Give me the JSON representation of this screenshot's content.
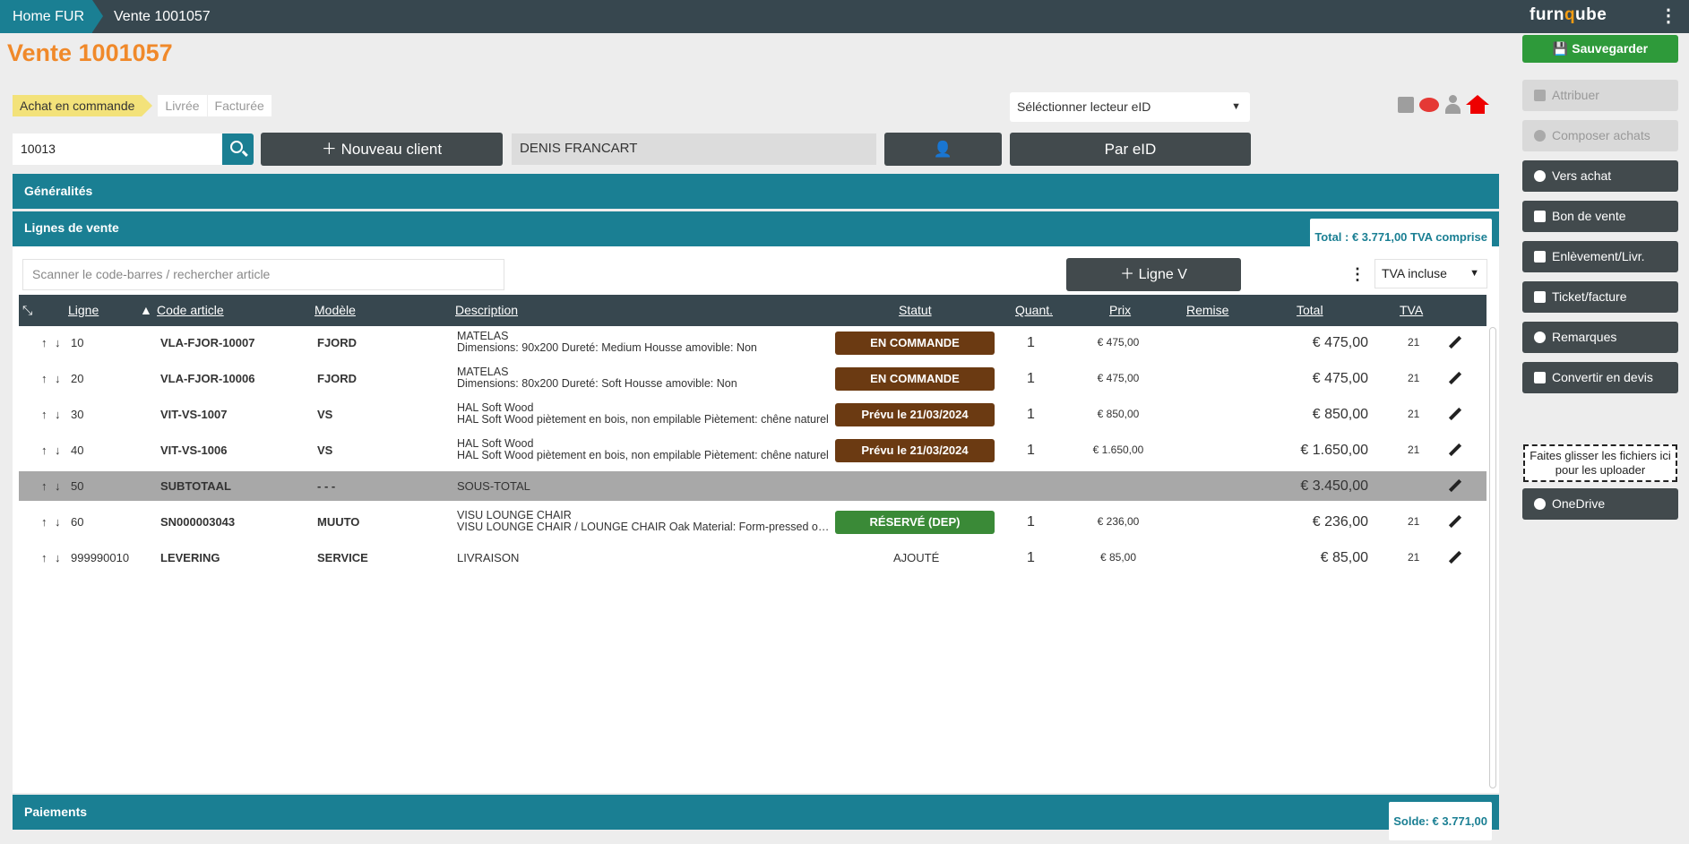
{
  "topbar": {
    "home": "Home FUR",
    "current": "Vente 1001057",
    "logo_a": "furn",
    "logo_q": "q",
    "logo_b": "ube"
  },
  "page_title": "Vente 1001057",
  "steps": [
    "Achat en commande",
    "Livrée",
    "Facturée"
  ],
  "eid_select": "Séléctionner lecteur eID",
  "client": {
    "number": "10013",
    "new_client": "Nouveau client",
    "name": "DENIS FRANCART",
    "by_eid": "Par eID"
  },
  "panels": {
    "generalites": "Généralités",
    "lignes": "Lignes de vente",
    "total": "Total : € 3.771,00 TVA comprise",
    "paiements": "Paiements",
    "solde": "Solde: € 3.771,00"
  },
  "lines": {
    "scan_placeholder": "Scanner le code-barres / rechercher article",
    "add_line": "Ligne V",
    "tva_select": "TVA incluse"
  },
  "columns": {
    "ligne": "Ligne",
    "code": "Code article",
    "modele": "Modèle",
    "description": "Description",
    "statut": "Statut",
    "quant": "Quant.",
    "prix": "Prix",
    "remise": "Remise",
    "total": "Total",
    "tva": "TVA"
  },
  "rows": [
    {
      "ligne": "10",
      "code": "VLA-FJOR-10007",
      "modele": "FJORD",
      "d1": "MATELAS",
      "d2": "Dimensions: 90x200 Dureté: Medium Housse amovible: Non",
      "statut": "EN COMMANDE",
      "color": "#6b3a12",
      "qty": "1",
      "prix": "€ 475,00",
      "total": "€ 475,00",
      "tva": "21"
    },
    {
      "ligne": "20",
      "code": "VLA-FJOR-10006",
      "modele": "FJORD",
      "d1": "MATELAS",
      "d2": "Dimensions: 80x200 Dureté: Soft Housse amovible: Non",
      "statut": "EN COMMANDE",
      "color": "#6b3a12",
      "qty": "1",
      "prix": "€ 475,00",
      "total": "€ 475,00",
      "tva": "21"
    },
    {
      "ligne": "30",
      "code": "VIT-VS-1007",
      "modele": "VS",
      "d1": "HAL Soft Wood",
      "d2": "HAL Soft Wood piètement en bois, non empilable Piètement: chêne naturel",
      "statut": "Prévu le 21/03/2024",
      "color": "#6b3a12",
      "qty": "1",
      "prix": "€ 850,00",
      "total": "€ 850,00",
      "tva": "21"
    },
    {
      "ligne": "40",
      "code": "VIT-VS-1006",
      "modele": "VS",
      "d1": "HAL Soft Wood",
      "d2": "HAL Soft Wood piètement en bois, non empilable Piètement: chêne naturel",
      "statut": "Prévu le 21/03/2024",
      "color": "#6b3a12",
      "qty": "1",
      "prix": "€ 1.650,00",
      "total": "€ 1.650,00",
      "tva": "21"
    },
    {
      "ligne": "50",
      "code": "SUBTOTAAL",
      "modele": "- - -",
      "d1": "SOUS-TOTAL",
      "d2": "",
      "statut": "",
      "color": "",
      "qty": "",
      "prix": "",
      "total": "€ 3.450,00",
      "tva": ""
    },
    {
      "ligne": "60",
      "code": "SN000003043",
      "modele": "MUUTO",
      "d1": "VISU LOUNGE CHAIR",
      "d2": "VISU LOUNGE CHAIR / LOUNGE CHAIR Oak Material: Form-pressed oak veneer",
      "statut": "RÉSERVÉ (DEP)",
      "color": "#3a8a37",
      "qty": "1",
      "prix": "€ 236,00",
      "total": "€ 236,00",
      "tva": "21"
    },
    {
      "ligne": "999990010",
      "code": "LEVERING",
      "modele": "SERVICE",
      "d1": "LIVRAISON",
      "d2": "",
      "statut": "AJOUTÉ",
      "color": "",
      "qty": "1",
      "prix": "€ 85,00",
      "total": "€ 85,00",
      "tva": "21"
    }
  ],
  "sidebar": {
    "save": "Sauvegarder",
    "attribuer": "Attribuer",
    "composer": "Composer achats",
    "vers_achat": "Vers achat",
    "bon_vente": "Bon de vente",
    "enlevement": "Enlèvement/Livr.",
    "ticket": "Ticket/facture",
    "remarques": "Remarques",
    "devis": "Convertir en devis",
    "dropzone": "Faites glisser les fichiers ici pour les uploader",
    "onedrive": "OneDrive"
  }
}
